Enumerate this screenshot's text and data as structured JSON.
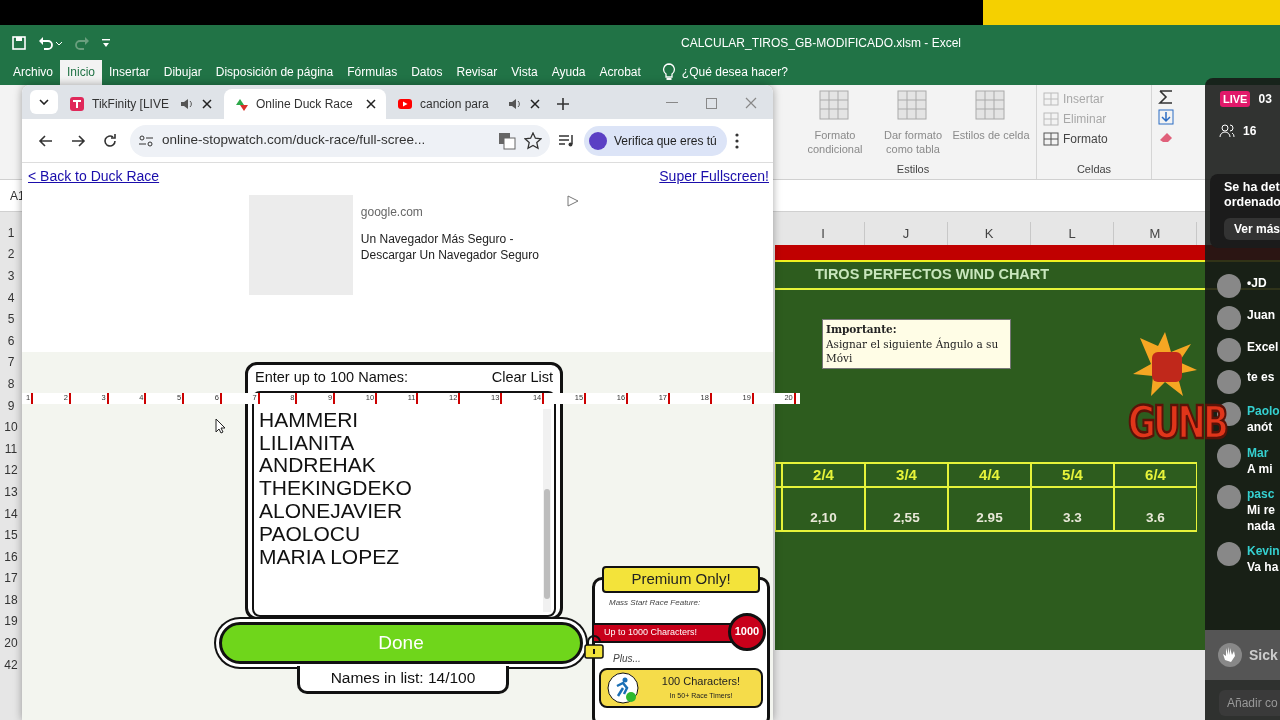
{
  "excel": {
    "title": "CALCULAR_TIROS_GB-MODIFICADO.xlsm  -  Excel",
    "menu": [
      {
        "label": "Archivo",
        "selected": false
      },
      {
        "label": "Inicio",
        "selected": true
      },
      {
        "label": "Insertar",
        "selected": false
      },
      {
        "label": "Dibujar",
        "selected": false
      },
      {
        "label": "Disposición de página",
        "selected": false
      },
      {
        "label": "Fórmulas",
        "selected": false
      },
      {
        "label": "Datos",
        "selected": false
      },
      {
        "label": "Revisar",
        "selected": false
      },
      {
        "label": "Vista",
        "selected": false
      },
      {
        "label": "Ayuda",
        "selected": false
      },
      {
        "label": "Acrobat",
        "selected": false
      }
    ],
    "tell_me": "¿Qué desea hacer?",
    "ribbon": {
      "estilos": {
        "buttons": [
          "Formato condicional",
          "Dar formato como tabla",
          "Estilos de celda"
        ],
        "label": "Estilos"
      },
      "celdas": {
        "items": [
          {
            "label": "Insertar",
            "disabled": true
          },
          {
            "label": "Eliminar",
            "disabled": true
          },
          {
            "label": "Formato",
            "disabled": false
          }
        ],
        "label": "Celdas"
      }
    },
    "name_box": "A1",
    "columns": [
      "I",
      "J",
      "K",
      "L",
      "M"
    ],
    "rows": [
      "1",
      "2",
      "3",
      "4",
      "5",
      "6",
      "7",
      "8",
      "9",
      "10",
      "11",
      "12",
      "13",
      "14",
      "15",
      "16",
      "17",
      "18",
      "19",
      "20",
      "42"
    ],
    "sheet": {
      "title": "TIROS PERFECTOS WIND CHART",
      "note": {
        "heading": "Importante:",
        "text": "Asignar el siguiente Ángulo a su Móvi"
      },
      "wind_headers": [
        "2/4",
        "3/4",
        "4/4",
        "5/4",
        "6/4"
      ],
      "wind_values": [
        "2,10",
        "2,55",
        "2.95",
        "3.3",
        "3.6"
      ]
    }
  },
  "browser": {
    "tabs": [
      {
        "title": "TikFinity [LIVE",
        "audio": true,
        "selected": false
      },
      {
        "title": "Online Duck Race",
        "audio": false,
        "selected": true
      },
      {
        "title": "cancion para",
        "audio": true,
        "selected": false
      }
    ],
    "url": "online-stopwatch.com/duck-race/full-scree...",
    "profile": "Verifica que eres tú",
    "page": {
      "back_link": "< Back to Duck Race",
      "fullscreen_link": "Super Fullscreen!",
      "ad": {
        "domain": "google.com",
        "text": "Un Navegador Más Seguro - Descargar Un Navegador Seguro"
      },
      "dialog": {
        "heading": "Enter up to 100 Names:",
        "clear": "Clear List",
        "names": [
          "HAMMERI",
          "LILIANITA",
          "ANDREHAK",
          "THEKINGDEKO",
          "ALONEJAVIER",
          "PAOLOCU",
          "MARIA LOPEZ"
        ],
        "done": "Done",
        "count": "Names in list: 14/100"
      },
      "premium": {
        "title": "Premium Only!",
        "feature": "Mass Start Race Feature:",
        "bar": "Up to 1000 Characters!",
        "bar_value": "1000",
        "plus": "Plus...",
        "card_title": "100 Characters!",
        "card_sub": "In 50+ Race Timers!"
      }
    }
  },
  "ruler": [
    "1",
    "2",
    "3",
    "4",
    "5",
    "6",
    "7",
    "8",
    "9",
    "10",
    "11",
    "12",
    "13",
    "14",
    "15",
    "16",
    "17",
    "18",
    "19",
    "20"
  ],
  "live": {
    "badge": "LIVE",
    "time": "03",
    "viewers": "16",
    "notice": "Se ha det ordenado",
    "notice_button": "Ver más",
    "logo": "GUNB",
    "messages": [
      {
        "name": "•JD"
      },
      {
        "name": "Juan"
      },
      {
        "name": "Excel"
      },
      {
        "text_lines": [
          "te es"
        ]
      },
      {
        "name": "Paolo",
        "text_lines": [
          "anót"
        ]
      },
      {
        "name": "Mar",
        "text_lines": [
          "A mi"
        ]
      },
      {
        "name": "pasc",
        "text_lines": [
          "Mi re",
          "nada"
        ]
      },
      {
        "name": "Kevin",
        "text_lines": [
          "Va ha"
        ]
      }
    ],
    "gift": "Sick",
    "input_placeholder": "Añadir co"
  }
}
